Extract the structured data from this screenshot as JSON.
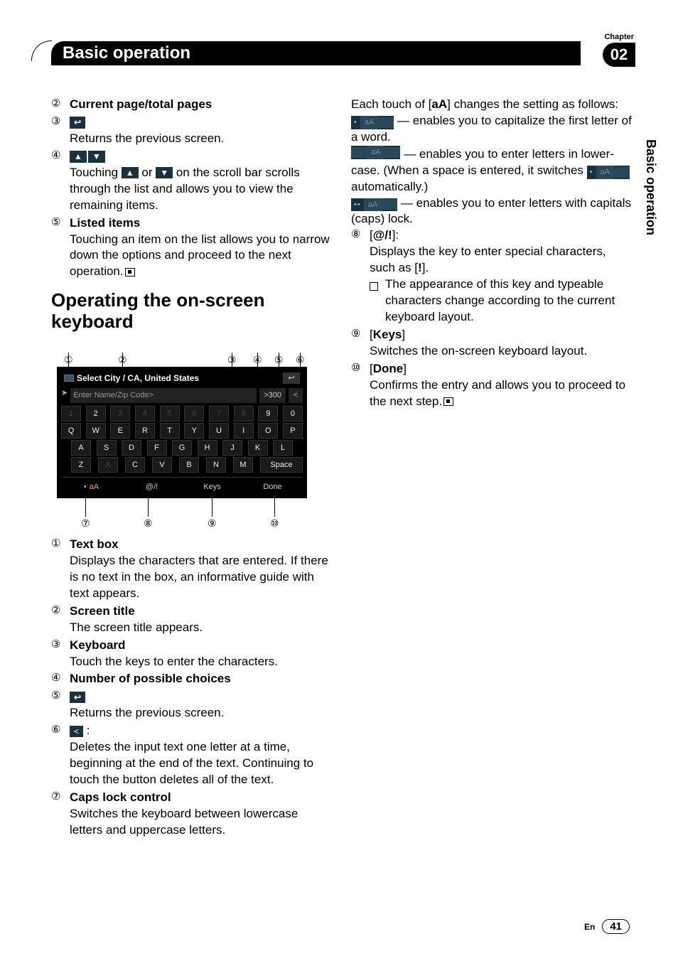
{
  "header": {
    "chapter_label": "Chapter",
    "chapter_number": "02",
    "title": "Basic operation",
    "side_tab": "Basic operation"
  },
  "footer": {
    "lang": "En",
    "page": "41"
  },
  "left": {
    "pre_items": [
      {
        "n": "②",
        "title": "Current page/total pages",
        "desc": ""
      },
      {
        "n": "③",
        "icon": "back",
        "desc": "Returns the previous screen."
      },
      {
        "n": "④",
        "icon": "scroll",
        "desc_a": "Touching ",
        "desc_b": " or ",
        "desc_c": " on the scroll bar scrolls through the list and allows you to view the remaining items."
      },
      {
        "n": "⑤",
        "title": "Listed items",
        "desc": "Touching an item on the list allows you to narrow down the options and proceed to the next operation."
      }
    ],
    "section_heading": "Operating the on-screen keyboard",
    "callouts_top": [
      "①",
      "②",
      "③",
      "④",
      "⑤",
      "⑥"
    ],
    "callouts_bot": [
      "⑦",
      "⑧",
      "⑨",
      "⑩"
    ],
    "kbd": {
      "title": "Select City / CA, United States",
      "placeholder": "Enter Name/Zip Code>",
      "count": ">300",
      "rows": [
        [
          "1",
          "2",
          "3",
          "4",
          "5",
          "6",
          "7",
          "8",
          "9",
          "0"
        ],
        [
          "Q",
          "W",
          "E",
          "R",
          "T",
          "Y",
          "U",
          "I",
          "O",
          "P"
        ],
        [
          "A",
          "S",
          "D",
          "F",
          "G",
          "H",
          "J",
          "K",
          "L"
        ],
        [
          "Z",
          "X",
          "C",
          "V",
          "B",
          "N",
          "M",
          "Space"
        ]
      ],
      "bottom": [
        "aA",
        "@/!",
        "Keys",
        "Done"
      ]
    },
    "post_items": [
      {
        "n": "①",
        "title": "Text box",
        "desc": "Displays the characters that are entered. If there is no text in the box, an informative guide with text appears."
      },
      {
        "n": "②",
        "title": "Screen title",
        "desc": "The screen title appears."
      },
      {
        "n": "③",
        "title": "Keyboard",
        "desc": "Touch the keys to enter the characters."
      },
      {
        "n": "④",
        "title": "Number of possible choices",
        "desc": ""
      },
      {
        "n": "⑤",
        "icon": "back",
        "desc": "Returns the previous screen."
      },
      {
        "n": "⑥",
        "icon": "delete",
        "suffix": ":",
        "desc": "Deletes the input text one letter at a time, beginning at the end of the text. Continuing to touch the button deletes all of the text."
      },
      {
        "n": "⑦",
        "title": "Caps lock control",
        "desc": "Switches the keyboard between lowercase letters and uppercase letters."
      }
    ]
  },
  "right": {
    "intro_a": "Each touch of [",
    "intro_b": "aA",
    "intro_c": "] changes the setting as follows:",
    "options": [
      {
        "dots": "•",
        "txt": " — enables you to capitalize the first letter of a word."
      },
      {
        "dots": "",
        "txt_a": " — enables you to enter letters in lower-case. (When a space is entered, it switches ",
        "txt_b": " automatically.)"
      },
      {
        "dots": "••",
        "txt": " — enables you to enter letters with capitals (caps) lock."
      }
    ],
    "items": [
      {
        "n": "⑧",
        "label_open": "[",
        "label": "@/!",
        "label_close": "]:",
        "desc": "Displays the key to enter special characters, such as [",
        "desc_bold": "!",
        "desc_close": "].",
        "note": "The appearance of this key and typeable characters change according to the current keyboard layout."
      },
      {
        "n": "⑨",
        "label_open": "[",
        "label": "Keys",
        "label_close": "]",
        "desc": "Switches the on-screen keyboard layout."
      },
      {
        "n": "⑩",
        "label_open": "[",
        "label": "Done",
        "label_close": "]",
        "desc": "Confirms the entry and allows you to proceed to the next step."
      }
    ]
  }
}
